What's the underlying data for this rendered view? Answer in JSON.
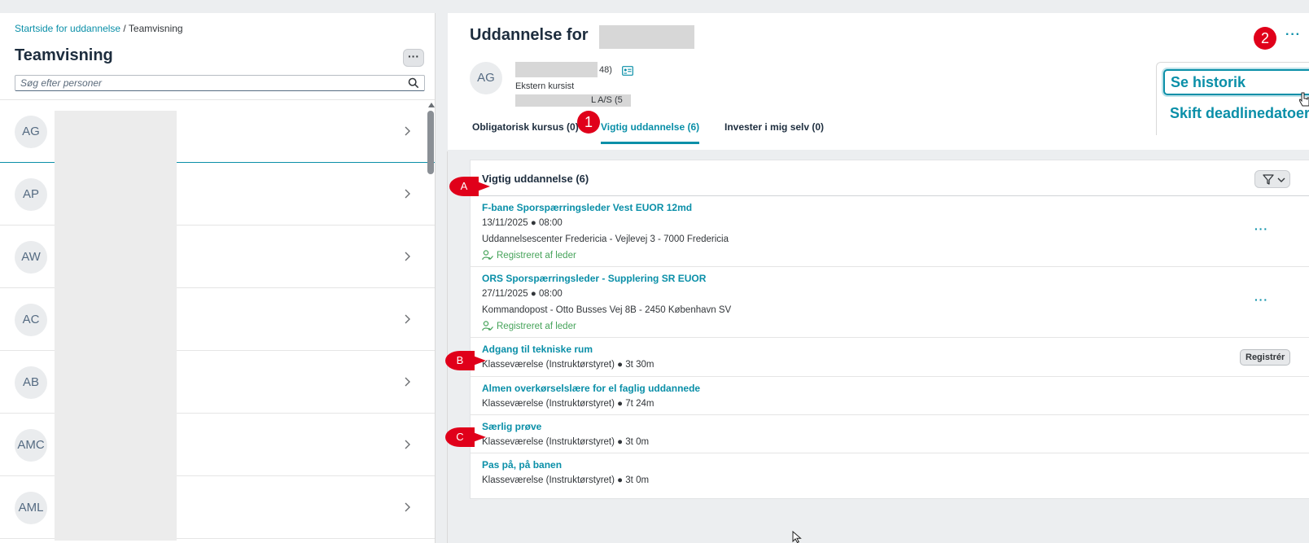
{
  "breadcrumb": {
    "home": "Startside for uddannelse",
    "separator": " / ",
    "current": "Teamvisning"
  },
  "left_panel": {
    "title": "Teamvisning",
    "more_label": "···",
    "search_placeholder": "Søg efter personer",
    "people": [
      {
        "initials": "AG"
      },
      {
        "initials": "AP"
      },
      {
        "initials": "AW"
      },
      {
        "initials": "AC"
      },
      {
        "initials": "AB"
      },
      {
        "initials": "AMC"
      },
      {
        "initials": "AML"
      }
    ]
  },
  "header": {
    "title": "Uddannelse for",
    "more_label": "···",
    "person": {
      "initials": "AG",
      "name_suffix": "48)",
      "role": "Ekstern kursist",
      "company_prefix": "L A/S (5"
    },
    "tabs": [
      {
        "label": "Obligatorisk kursus (0)"
      },
      {
        "label": "Vigtig uddannelse (6)"
      },
      {
        "label": "Invester i mig selv (0)"
      }
    ]
  },
  "popover": {
    "history": "Se historik",
    "deadline": "Skift deadlinedatoer"
  },
  "section": {
    "title": "Vigtig uddannelse (6)",
    "courses": [
      {
        "title": "F-bane Sporspærringsleder Vest EUOR 12md",
        "date": "13/11/2025 ● 08:00",
        "location": "Uddannelsescenter Fredericia - Vejlevej 3 - 7000 Fredericia",
        "status": "Registreret af leder",
        "more": "···"
      },
      {
        "title": "ORS Sporspærringsleder - Supplering SR EUOR",
        "date": "27/11/2025 ● 08:00",
        "location": "Kommandopost - Otto Busses Vej 8B - 2450 København SV",
        "status": "Registreret af leder",
        "more": "···"
      },
      {
        "title": "Adgang til tekniske rum",
        "detail": "Klasseværelse (Instruktørstyret) ● 3t 30m",
        "action": "Registrér"
      },
      {
        "title": "Almen overkørselslære for el faglig uddannede",
        "detail": "Klasseværelse (Instruktørstyret) ● 7t 24m"
      },
      {
        "title": "Særlig prøve",
        "detail": "Klasseværelse (Instruktørstyret) ● 3t 0m"
      },
      {
        "title": "Pas på, på banen",
        "detail": "Klasseværelse (Instruktørstyret) ● 3t 0m"
      }
    ]
  },
  "annotations": {
    "one": "1",
    "two": "2",
    "a": "A",
    "b": "B",
    "c": "C"
  },
  "colors": {
    "accent": "#0a8fa8",
    "success": "#46a35a",
    "annotation": "#e0001a"
  }
}
